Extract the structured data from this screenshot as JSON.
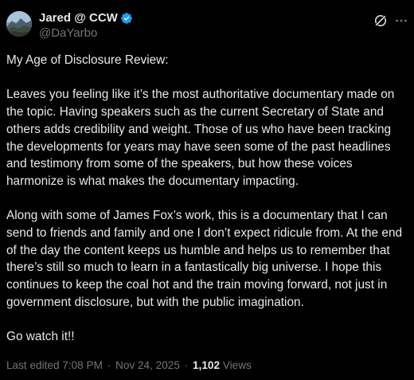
{
  "author": {
    "display_name": "Jared @ CCW",
    "handle": "@DaYarbo",
    "verified": true,
    "avatar_icon": "mountain-landscape-avatar"
  },
  "header_actions": {
    "grok_icon": "grok-icon",
    "more_icon": "more-options-icon"
  },
  "post": {
    "paragraphs": [
      "My Age of Disclosure Review:",
      "Leaves you feeling like it’s the most authoritative documentary made on the topic. Having speakers such as the current Secretary of State and others adds credibility and weight. Those of us who have been tracking the developments for years may have seen some of the past headlines and testimony from some of the speakers, but how these voices harmonize is what makes the documentary impacting.",
      "Along with some of James Fox’s work, this is a documentary that I can send to friends and family and one I don’t expect ridicule from. At the end of the day the content keeps us humble and helps us to remember that there’s still so much to learn in a fantastically big universe. I hope this continues to keep the coal hot and the train moving forward, not just in government disclosure, but with the public imagination.",
      "Go watch it!!"
    ]
  },
  "meta": {
    "edited_label": "Last edited 7:08 PM",
    "date": "Nov 24, 2025",
    "views_count": "1,102",
    "views_label": "Views",
    "separator": "·"
  },
  "colors": {
    "background": "#000000",
    "text_primary": "#e7e9ea",
    "text_secondary": "#71767b",
    "verified_badge": "#1d9bf0"
  }
}
